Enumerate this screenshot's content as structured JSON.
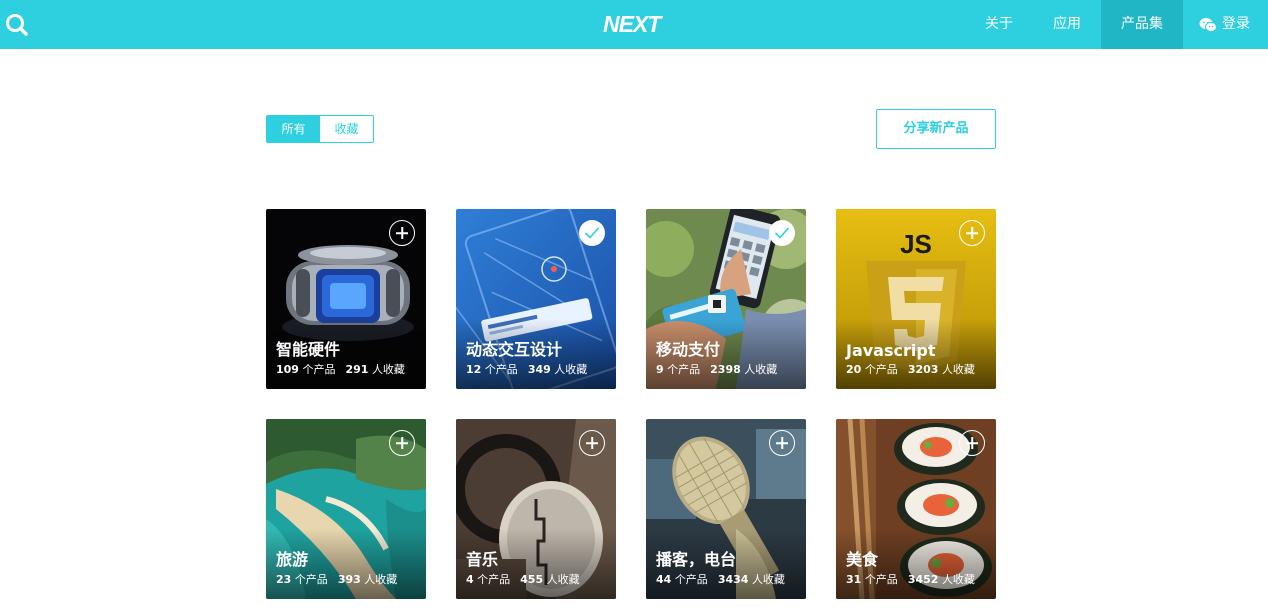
{
  "header": {
    "logo": "NEXT",
    "nav": [
      {
        "label": "关于"
      },
      {
        "label": "应用"
      },
      {
        "label": "产品集",
        "active": true
      },
      {
        "label": "登录"
      }
    ]
  },
  "filter": {
    "options": [
      "所有",
      "收藏"
    ],
    "selected": "所有"
  },
  "share_button": "分享新产品",
  "cards": [
    {
      "title": "智能硬件",
      "products": "109",
      "products_unit": "个产品",
      "favs": "291",
      "favs_unit": "人收藏",
      "saved": false
    },
    {
      "title": "动态交互设计",
      "products": "12",
      "products_unit": "个产品",
      "favs": "349",
      "favs_unit": "人收藏",
      "saved": true
    },
    {
      "title": "移动支付",
      "products": "9",
      "products_unit": "个产品",
      "favs": "2398",
      "favs_unit": "人收藏",
      "saved": true
    },
    {
      "title": "Javascript",
      "products": "20",
      "products_unit": "个产品",
      "favs": "3203",
      "favs_unit": "人收藏",
      "saved": false
    },
    {
      "title": "旅游",
      "products": "23",
      "products_unit": "个产品",
      "favs": "393",
      "favs_unit": "人收藏",
      "saved": false
    },
    {
      "title": "音乐",
      "products": "4",
      "products_unit": "个产品",
      "favs": "455",
      "favs_unit": "人收藏",
      "saved": false
    },
    {
      "title": "播客，电台",
      "products": "44",
      "products_unit": "个产品",
      "favs": "3434",
      "favs_unit": "人收藏",
      "saved": false
    },
    {
      "title": "美食",
      "products": "31",
      "products_unit": "个产品",
      "favs": "3452",
      "favs_unit": "人收藏",
      "saved": false
    }
  ],
  "colors": {
    "accent": "#2ecfdf",
    "accent_dark": "#20b6c6"
  }
}
